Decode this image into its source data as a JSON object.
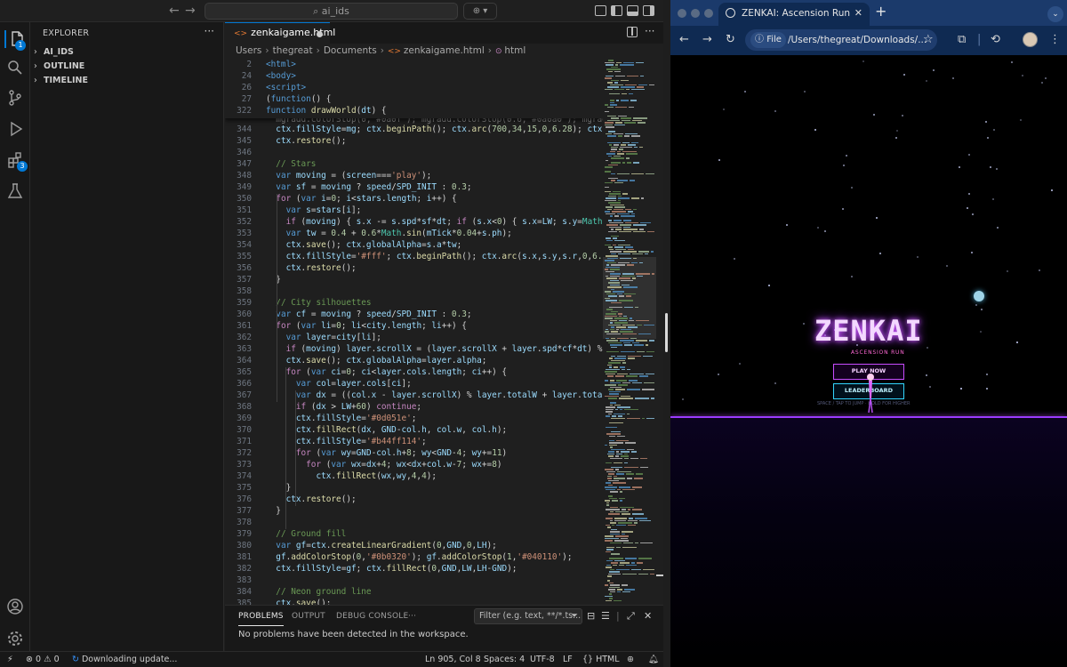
{
  "vscode": {
    "command_center": "ai_ids",
    "sidebar": {
      "title": "EXPLORER",
      "sections": [
        "AI_IDS",
        "OUTLINE",
        "TIMELINE"
      ]
    },
    "activity_badges": {
      "explorer": "1",
      "extensions": "3"
    },
    "editor": {
      "tab_label": "zenkaigame.html",
      "breadcrumb": [
        "Users",
        "thegreat",
        "Documents",
        "zenkaigame.html",
        "html"
      ]
    },
    "panel": {
      "tabs": [
        "PROBLEMS",
        "OUTPUT",
        "DEBUG CONSOLE"
      ],
      "filter_placeholder": "Filter (e.g. text, **/*.ts...",
      "message": "No problems have been detected in the workspace."
    },
    "status": {
      "errors": "0",
      "warnings": "0",
      "update": "Downloading update...",
      "position": "Ln 905, Col 8",
      "spaces": "Spaces: 4",
      "encoding": "UTF-8",
      "eol": "LF",
      "language": "HTML"
    }
  },
  "code_lines": [
    {
      "n": "2",
      "html": "<span class=\"k\">&lt;html&gt;</span>"
    },
    {
      "n": "24",
      "html": "<span class=\"k\">&lt;body&gt;</span>"
    },
    {
      "n": "26",
      "html": "<span class=\"k\">&lt;script&gt;</span>"
    },
    {
      "n": "27",
      "html": "(<span class=\"k\">function</span>() {"
    },
    {
      "n": "322",
      "html": "<span class=\"k\">function</span> <span class=\"f\">drawWorld</span>(<span class=\"v\">dt</span>) {"
    },
    {
      "n": "344",
      "html": "  <span class=\"v\">ctx</span>.<span class=\"v\">fillStyle</span>=<span class=\"v\">mg</span>; <span class=\"v\">ctx</span>.<span class=\"f\">beginPath</span>(); <span class=\"v\">ctx</span>.<span class=\"f\">arc</span>(<span class=\"n\">700</span>,<span class=\"n\">34</span>,<span class=\"n\">15</span>,<span class=\"n\">0</span>,<span class=\"n\">6.28</span>); <span class=\"v\">ctx</span>.<span class=\"f\">fill</span>("
    },
    {
      "n": "345",
      "html": "  <span class=\"v\">ctx</span>.<span class=\"f\">restore</span>();"
    },
    {
      "n": "346",
      "html": ""
    },
    {
      "n": "347",
      "html": "  <span class=\"c\">// Stars</span>"
    },
    {
      "n": "348",
      "html": "  <span class=\"k\">var</span> <span class=\"v\">moving</span> = (<span class=\"v\">screen</span>===<span class=\"s\">'play'</span>);"
    },
    {
      "n": "349",
      "html": "  <span class=\"k\">var</span> <span class=\"v\">sf</span> = <span class=\"v\">moving</span> ? <span class=\"v\">speed</span>/<span class=\"v\">SPD_INIT</span> : <span class=\"n\">0.3</span>;"
    },
    {
      "n": "350",
      "html": "  <span class=\"kw\">for</span> (<span class=\"k\">var</span> <span class=\"v\">i</span>=<span class=\"n\">0</span>; <span class=\"v\">i</span>&lt;<span class=\"v\">stars</span>.<span class=\"v\">length</span>; <span class=\"v\">i</span>++) {"
    },
    {
      "n": "351",
      "html": "    <span class=\"k\">var</span> <span class=\"v\">s</span>=<span class=\"v\">stars</span>[<span class=\"v\">i</span>];"
    },
    {
      "n": "352",
      "html": "    <span class=\"kw\">if</span> (<span class=\"v\">moving</span>) { <span class=\"v\">s</span>.<span class=\"v\">x</span> -= <span class=\"v\">s</span>.<span class=\"v\">spd</span>*<span class=\"v\">sf</span>*<span class=\"v\">dt</span>; <span class=\"kw\">if</span> (<span class=\"v\">s</span>.<span class=\"v\">x</span>&lt;<span class=\"n\">0</span>) { <span class=\"v\">s</span>.<span class=\"v\">x</span>=<span class=\"v\">LW</span>; <span class=\"v\">s</span>.<span class=\"v\">y</span>=<span class=\"t\">Math</span>.<span class=\"f\">rando</span>"
    },
    {
      "n": "353",
      "html": "    <span class=\"k\">var</span> <span class=\"v\">tw</span> = <span class=\"n\">0.4</span> + <span class=\"n\">0.6</span>*<span class=\"t\">Math</span>.<span class=\"f\">sin</span>(<span class=\"v\">mTick</span>*<span class=\"n\">0.04</span>+<span class=\"v\">s</span>.<span class=\"v\">ph</span>);"
    },
    {
      "n": "354",
      "html": "    <span class=\"v\">ctx</span>.<span class=\"f\">save</span>(); <span class=\"v\">ctx</span>.<span class=\"v\">globalAlpha</span>=<span class=\"v\">s</span>.<span class=\"v\">a</span>*<span class=\"v\">tw</span>;"
    },
    {
      "n": "355",
      "html": "    <span class=\"v\">ctx</span>.<span class=\"v\">fillStyle</span>=<span class=\"s\">'#fff'</span>; <span class=\"v\">ctx</span>.<span class=\"f\">beginPath</span>(); <span class=\"v\">ctx</span>.<span class=\"f\">arc</span>(<span class=\"v\">s</span>.<span class=\"v\">x</span>,<span class=\"v\">s</span>.<span class=\"v\">y</span>,<span class=\"v\">s</span>.<span class=\"v\">r</span>,<span class=\"n\">0</span>,<span class=\"n\">6.28</span>); <span class=\"v\">c</span>"
    },
    {
      "n": "356",
      "html": "    <span class=\"v\">ctx</span>.<span class=\"f\">restore</span>();"
    },
    {
      "n": "357",
      "html": "  }"
    },
    {
      "n": "358",
      "html": ""
    },
    {
      "n": "359",
      "html": "  <span class=\"c\">// City silhouettes</span>"
    },
    {
      "n": "360",
      "html": "  <span class=\"k\">var</span> <span class=\"v\">cf</span> = <span class=\"v\">moving</span> ? <span class=\"v\">speed</span>/<span class=\"v\">SPD_INIT</span> : <span class=\"n\">0.3</span>;"
    },
    {
      "n": "361",
      "html": "  <span class=\"kw\">for</span> (<span class=\"k\">var</span> <span class=\"v\">li</span>=<span class=\"n\">0</span>; <span class=\"v\">li</span>&lt;<span class=\"v\">city</span>.<span class=\"v\">length</span>; <span class=\"v\">li</span>++) {"
    },
    {
      "n": "362",
      "html": "    <span class=\"k\">var</span> <span class=\"v\">layer</span>=<span class=\"v\">city</span>[<span class=\"v\">li</span>];"
    },
    {
      "n": "363",
      "html": "    <span class=\"kw\">if</span> (<span class=\"v\">moving</span>) <span class=\"v\">layer</span>.<span class=\"v\">scrollX</span> = (<span class=\"v\">layer</span>.<span class=\"v\">scrollX</span> + <span class=\"v\">layer</span>.<span class=\"v\">spd</span>*<span class=\"v\">cf</span>*<span class=\"v\">dt</span>) % <span class=\"v\">layer</span>"
    },
    {
      "n": "364",
      "html": "    <span class=\"v\">ctx</span>.<span class=\"f\">save</span>(); <span class=\"v\">ctx</span>.<span class=\"v\">globalAlpha</span>=<span class=\"v\">layer</span>.<span class=\"v\">alpha</span>;"
    },
    {
      "n": "365",
      "html": "    <span class=\"kw\">for</span> (<span class=\"k\">var</span> <span class=\"v\">ci</span>=<span class=\"n\">0</span>; <span class=\"v\">ci</span>&lt;<span class=\"v\">layer</span>.<span class=\"v\">cols</span>.<span class=\"v\">length</span>; <span class=\"v\">ci</span>++) {"
    },
    {
      "n": "366",
      "html": "      <span class=\"k\">var</span> <span class=\"v\">col</span>=<span class=\"v\">layer</span>.<span class=\"v\">cols</span>[<span class=\"v\">ci</span>];"
    },
    {
      "n": "367",
      "html": "      <span class=\"k\">var</span> <span class=\"v\">dx</span> = ((<span class=\"v\">col</span>.<span class=\"v\">x</span> - <span class=\"v\">layer</span>.<span class=\"v\">scrollX</span>) % <span class=\"v\">layer</span>.<span class=\"v\">totalW</span> + <span class=\"v\">layer</span>.<span class=\"v\">totalW</span>) %"
    },
    {
      "n": "368",
      "html": "      <span class=\"kw\">if</span> (<span class=\"v\">dx</span> &gt; <span class=\"v\">LW</span>+<span class=\"n\">60</span>) <span class=\"kw\">continue</span>;"
    },
    {
      "n": "369",
      "html": "      <span class=\"v\">ctx</span>.<span class=\"v\">fillStyle</span>=<span class=\"s\">'#0d051e'</span>;"
    },
    {
      "n": "370",
      "html": "      <span class=\"v\">ctx</span>.<span class=\"f\">fillRect</span>(<span class=\"v\">dx</span>, <span class=\"v\">GND</span>-<span class=\"v\">col</span>.<span class=\"v\">h</span>, <span class=\"v\">col</span>.<span class=\"v\">w</span>, <span class=\"v\">col</span>.<span class=\"v\">h</span>);"
    },
    {
      "n": "371",
      "html": "      <span class=\"v\">ctx</span>.<span class=\"v\">fillStyle</span>=<span class=\"s\">'#b44ff114'</span>;"
    },
    {
      "n": "372",
      "html": "      <span class=\"kw\">for</span> (<span class=\"k\">var</span> <span class=\"v\">wy</span>=<span class=\"v\">GND</span>-<span class=\"v\">col</span>.<span class=\"v\">h</span>+<span class=\"n\">8</span>; <span class=\"v\">wy</span>&lt;<span class=\"v\">GND</span>-<span class=\"n\">4</span>; <span class=\"v\">wy</span>+=<span class=\"n\">11</span>)"
    },
    {
      "n": "373",
      "html": "        <span class=\"kw\">for</span> (<span class=\"k\">var</span> <span class=\"v\">wx</span>=<span class=\"v\">dx</span>+<span class=\"n\">4</span>; <span class=\"v\">wx</span>&lt;<span class=\"v\">dx</span>+<span class=\"v\">col</span>.<span class=\"v\">w</span>-<span class=\"n\">7</span>; <span class=\"v\">wx</span>+=<span class=\"n\">8</span>)"
    },
    {
      "n": "374",
      "html": "          <span class=\"v\">ctx</span>.<span class=\"f\">fillRect</span>(<span class=\"v\">wx</span>,<span class=\"v\">wy</span>,<span class=\"n\">4</span>,<span class=\"n\">4</span>);"
    },
    {
      "n": "375",
      "html": "    }"
    },
    {
      "n": "376",
      "html": "    <span class=\"v\">ctx</span>.<span class=\"f\">restore</span>();"
    },
    {
      "n": "377",
      "html": "  }"
    },
    {
      "n": "378",
      "html": ""
    },
    {
      "n": "379",
      "html": "  <span class=\"c\">// Ground fill</span>"
    },
    {
      "n": "380",
      "html": "  <span class=\"k\">var</span> <span class=\"v\">gf</span>=<span class=\"v\">ctx</span>.<span class=\"f\">createLinearGradient</span>(<span class=\"n\">0</span>,<span class=\"v\">GND</span>,<span class=\"n\">0</span>,<span class=\"v\">LH</span>);"
    },
    {
      "n": "381",
      "html": "  <span class=\"v\">gf</span>.<span class=\"f\">addColorStop</span>(<span class=\"n\">0</span>,<span class=\"s\">'#0b0320'</span>); <span class=\"v\">gf</span>.<span class=\"f\">addColorStop</span>(<span class=\"n\">1</span>,<span class=\"s\">'#040110'</span>);"
    },
    {
      "n": "382",
      "html": "  <span class=\"v\">ctx</span>.<span class=\"v\">fillStyle</span>=<span class=\"v\">gf</span>; <span class=\"v\">ctx</span>.<span class=\"f\">fillRect</span>(<span class=\"n\">0</span>,<span class=\"v\">GND</span>,<span class=\"v\">LW</span>,<span class=\"v\">LH</span>-<span class=\"v\">GND</span>);"
    },
    {
      "n": "383",
      "html": ""
    },
    {
      "n": "384",
      "html": "  <span class=\"c\">// Neon ground line</span>"
    },
    {
      "n": "385",
      "html": "  <span class=\"v\">ctx</span>.<span class=\"f\">save</span>();"
    }
  ],
  "browser": {
    "tab_title": "ZENKAI: Ascension Run",
    "omnibox_chip": "File",
    "url": "/Users/thegreat/Downloads/..."
  },
  "game": {
    "title": "ZENKAI",
    "subtitle": "ASCENSION RUN",
    "play_label": "PLAY NOW",
    "leaderboard_label": "LEADERBOARD",
    "hint": "SPACE / TAP TO JUMP · HOLD FOR HIGHER"
  },
  "colors": {
    "accent": "#0078d4",
    "neon_purple": "#b44ff1",
    "neon_cyan": "#33d6ff",
    "chrome_frame": "#1b3a6b"
  }
}
